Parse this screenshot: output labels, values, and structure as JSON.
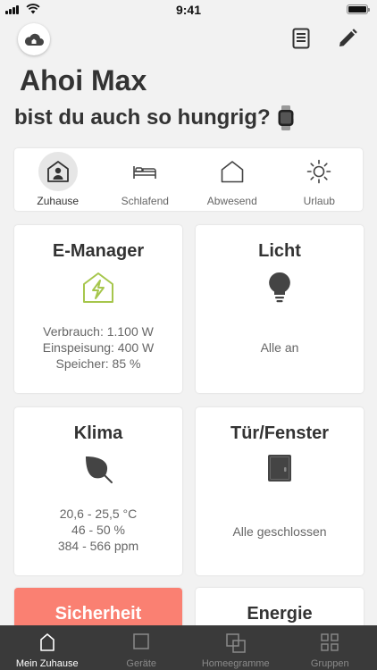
{
  "status_bar": {
    "time": "9:41"
  },
  "header": {
    "greeting": "Ahoi Max",
    "subtitle": "bist du auch so hungrig?"
  },
  "modes": [
    {
      "label": "Zuhause",
      "icon": "home-person-icon",
      "active": true
    },
    {
      "label": "Schlafend",
      "icon": "bed-icon",
      "active": false
    },
    {
      "label": "Abwesend",
      "icon": "house-outline-icon",
      "active": false
    },
    {
      "label": "Urlaub",
      "icon": "sun-icon",
      "active": false
    }
  ],
  "cards": {
    "emanager": {
      "title": "E-Manager",
      "lines": [
        "Verbrauch: 1.100 W",
        "Einspeisung: 400 W",
        "Speicher: 85 %"
      ],
      "accent": "#a6c64c"
    },
    "licht": {
      "title": "Licht",
      "lines": [
        "Alle an"
      ]
    },
    "klima": {
      "title": "Klima",
      "lines": [
        "20,6 - 25,5 °C",
        "46 - 50 %",
        "384 - 566 ppm"
      ]
    },
    "tuer": {
      "title": "Tür/Fenster",
      "lines": [
        "Alle geschlossen"
      ]
    },
    "sicherheit": {
      "title": "Sicherheit",
      "color": "#fa8072"
    },
    "energie": {
      "title": "Energie"
    }
  },
  "tabs": [
    {
      "label": "Mein Zuhause",
      "active": true
    },
    {
      "label": "Geräte",
      "active": false
    },
    {
      "label": "Homeegramme",
      "active": false
    },
    {
      "label": "Gruppen",
      "active": false
    }
  ]
}
